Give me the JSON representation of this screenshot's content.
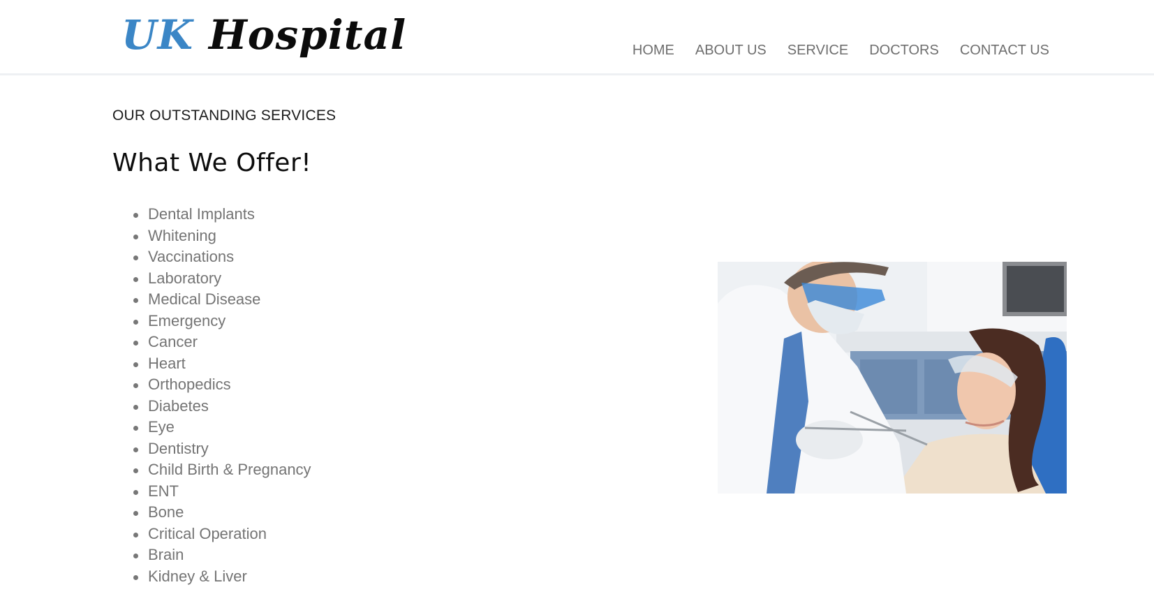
{
  "header": {
    "logo_part1": "UK",
    "logo_part2": "Hospital",
    "nav": [
      "HOME",
      "ABOUT US",
      "SERVICE",
      "DOCTORS",
      "CONTACT US"
    ]
  },
  "main": {
    "eyebrow": "OUR OUTSTANDING SERVICES",
    "title": "What We Offer!",
    "services": [
      "Dental Implants",
      "Whitening",
      "Vaccinations",
      "Laboratory",
      "Medical Disease",
      "Emergency",
      "Cancer",
      "Heart",
      "Orthopedics",
      "Diabetes",
      "Eye",
      "Dentistry",
      "Child Birth & Pregnancy",
      "ENT",
      "Bone",
      "Critical Operation",
      "Brain",
      "Kidney & Liver"
    ]
  },
  "colors": {
    "logo_blue": "#3b86c6",
    "nav_text": "#6e6e6e",
    "list_text": "#747474"
  }
}
